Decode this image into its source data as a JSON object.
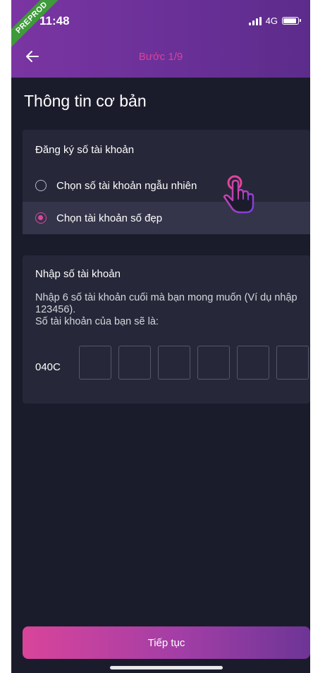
{
  "status_bar": {
    "ribbon": "PREPROD",
    "time": "11:48",
    "network": "4G"
  },
  "header": {
    "step_title": "Bước 1/9",
    "back_icon": "arrow-left-icon"
  },
  "page": {
    "title": "Thông tin cơ bản"
  },
  "register_card": {
    "title": "Đăng ký số tài khoản",
    "options": [
      {
        "label": "Chọn số tài khoản ngẫu nhiên",
        "selected": false
      },
      {
        "label": "Chọn tài khoản số đẹp",
        "selected": true
      }
    ]
  },
  "input_card": {
    "title": "Nhập số tài khoản",
    "description": "Nhập 6 số tài khoản cuối mà bạn mong muốn (Ví dụ nhập 123456).",
    "result_label": "Số tài khoản của bạn sẽ là:",
    "prefix": "040C",
    "digits": [
      "",
      "",
      "",
      "",
      "",
      ""
    ]
  },
  "footer": {
    "continue_label": "Tiếp tục"
  },
  "colors": {
    "accent": "#e0459a",
    "header_purple": "#6a3098",
    "background": "#1b1c2b",
    "card": "#262738"
  }
}
